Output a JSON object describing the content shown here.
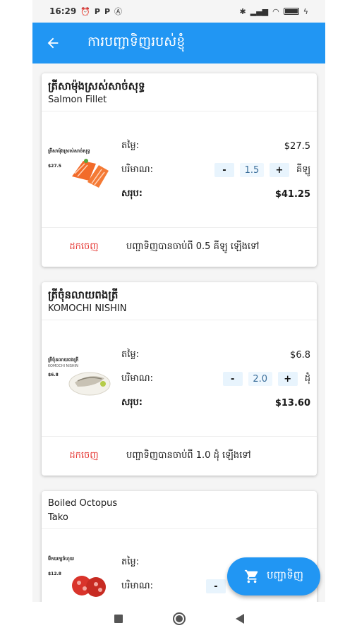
{
  "status_bar": {
    "time": "16:29",
    "left_icons": [
      "alarm-icon",
      "p-icon",
      "p-icon",
      "a-icon"
    ],
    "right_icons": [
      "bluetooth-icon",
      "signal-icon",
      "wifi-icon",
      "battery-icon",
      "charging-icon"
    ]
  },
  "appbar": {
    "title": "ការបញ្ជាទិញរបស់ខ្ញុំ",
    "color": "#2196f3"
  },
  "labels": {
    "price": "តម្លៃ:",
    "quantity": "បរិមាណ:",
    "total": "សរុប:",
    "remove": "ដកចេញ"
  },
  "items": [
    {
      "name_km": "ត្រីសាម៉ុងស្រស់សាច់សុទ្ធ",
      "name_en": "Salmon Fillet",
      "thumb_caption": "ត្រីសាម៉ុងស្រស់សាច់សុទ្ធ",
      "thumb_price": "$27.5",
      "price": "$27.5",
      "qty_minus": "-",
      "quantity": "1.5",
      "qty_plus": "+",
      "unit": "គីឡូ",
      "total": "$41.25",
      "note": "បញ្ជាទិញបានចាប់ពី 0.5 គីឡូ ឡើងទៅ"
    },
    {
      "name_km": "ត្រីចុំនលាយពងត្រី",
      "name_en": "KOMOCHI NISHIN",
      "thumb_caption": "ត្រីចុំនលាយពងត្រី",
      "thumb_caption_en": "KOMOCHI NISHIN",
      "thumb_price": "$6.8",
      "price": "$6.8",
      "qty_minus": "-",
      "quantity": "2.0",
      "qty_plus": "+",
      "unit": "ដុំ",
      "total": "$13.60",
      "note": "បញ្ជាទិញបានចាប់ពី 1.0 ដុំ ឡើងទៅ"
    },
    {
      "name_km": "Boiled Octopus",
      "name_en": "Tako",
      "thumb_caption": "មឹកយក្សចំហុយ",
      "thumb_price": "$12.8",
      "qty_minus": "-"
    }
  ],
  "fab": {
    "label": "បញ្ជាទិញ"
  }
}
